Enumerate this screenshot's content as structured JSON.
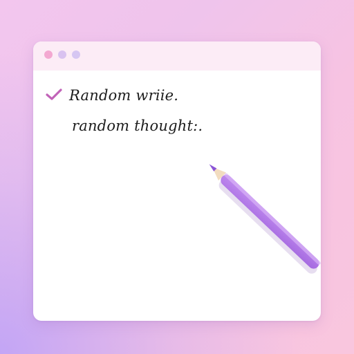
{
  "window": {
    "titlebar_dots": [
      "pink",
      "lavender",
      "lavender"
    ]
  },
  "notes": [
    {
      "text": "Random wriie.",
      "checked": true
    },
    {
      "text": "random thought:.",
      "checked": false
    }
  ],
  "icons": {
    "check": "check-icon",
    "pencil": "pencil-icon"
  },
  "colors": {
    "check": "#c163b8",
    "pencil": "#b477e6",
    "dot_pink": "#f3a8d1",
    "dot_lavender": "#d9c2f0"
  }
}
